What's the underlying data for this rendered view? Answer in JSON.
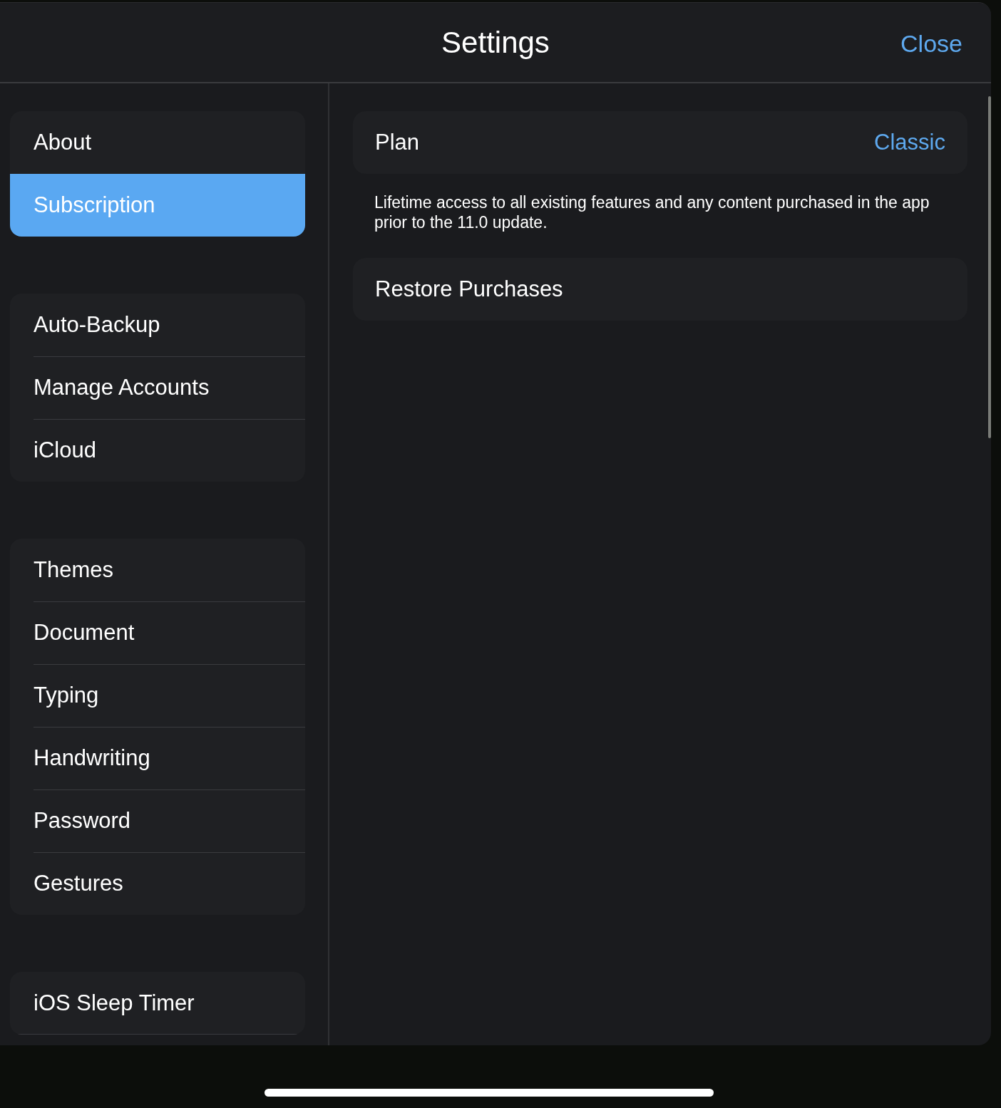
{
  "header": {
    "title": "Settings",
    "close": "Close"
  },
  "sidebar": {
    "groups": [
      {
        "items": [
          {
            "label": "About",
            "selected": false
          },
          {
            "label": "Subscription",
            "selected": true
          }
        ]
      },
      {
        "items": [
          {
            "label": "Auto-Backup",
            "selected": false
          },
          {
            "label": "Manage Accounts",
            "selected": false
          },
          {
            "label": "iCloud",
            "selected": false
          }
        ]
      },
      {
        "items": [
          {
            "label": "Themes",
            "selected": false
          },
          {
            "label": "Document",
            "selected": false
          },
          {
            "label": "Typing",
            "selected": false
          },
          {
            "label": "Handwriting",
            "selected": false
          },
          {
            "label": "Password",
            "selected": false
          },
          {
            "label": "Gestures",
            "selected": false
          }
        ]
      },
      {
        "items": [
          {
            "label": "iOS Sleep Timer",
            "selected": false
          }
        ]
      }
    ]
  },
  "content": {
    "plan": {
      "label": "Plan",
      "value": "Classic"
    },
    "description": "Lifetime access to all existing features and any content purchased in the app prior to the 11.0 update.",
    "restore": "Restore Purchases"
  }
}
